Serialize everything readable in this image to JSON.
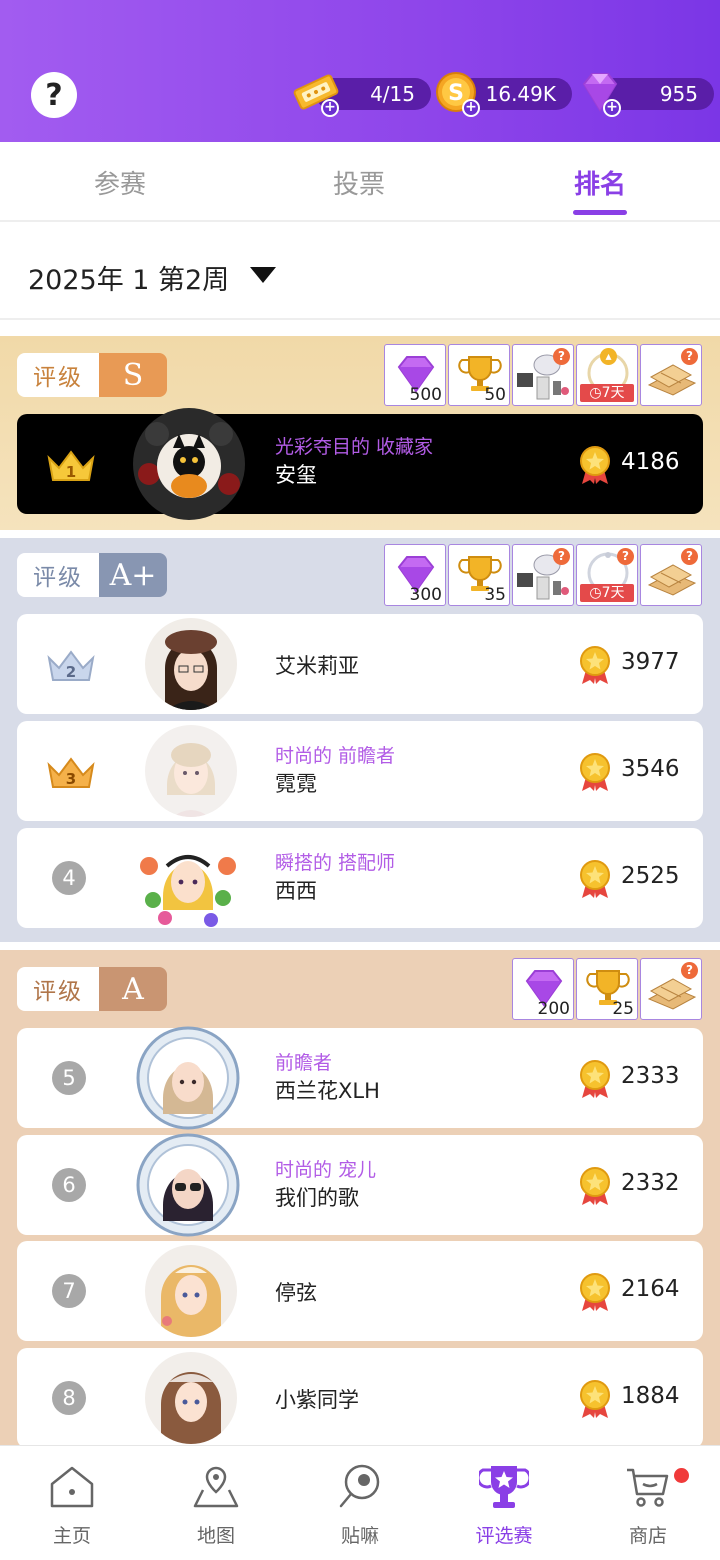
{
  "header": {
    "help_label": "?",
    "tickets": "4/15",
    "coins": "16.49K",
    "diamonds": "955",
    "accent_color": "#8e45ea"
  },
  "tabs": [
    {
      "label": "参赛",
      "active": false
    },
    {
      "label": "投票",
      "active": false
    },
    {
      "label": "排名",
      "active": true
    }
  ],
  "period": {
    "label": "2025年 1 第2周"
  },
  "tiers": {
    "s": {
      "label": "评级",
      "grade": "S",
      "rewards": [
        {
          "icon": "diamond-icon",
          "qty": "500"
        },
        {
          "icon": "trophy-icon",
          "qty": "50"
        },
        {
          "icon": "outfit-icon",
          "qty": ""
        },
        {
          "icon": "frame-icon",
          "qty": "",
          "timer": "7天"
        },
        {
          "icon": "chest-icon",
          "qty": ""
        }
      ]
    },
    "ap": {
      "label": "评级",
      "grade": "A+",
      "rewards": [
        {
          "icon": "diamond-icon",
          "qty": "300"
        },
        {
          "icon": "trophy-icon",
          "qty": "35"
        },
        {
          "icon": "outfit-icon",
          "qty": ""
        },
        {
          "icon": "frame-icon",
          "qty": "",
          "timer": "7天"
        },
        {
          "icon": "chest-icon",
          "qty": ""
        }
      ]
    },
    "a": {
      "label": "评级",
      "grade": "A",
      "rewards": [
        {
          "icon": "diamond-icon",
          "qty": "200"
        },
        {
          "icon": "trophy-icon",
          "qty": "25"
        },
        {
          "icon": "chest-icon",
          "qty": ""
        }
      ]
    }
  },
  "ranking": [
    {
      "rank": "1",
      "title": "光彩夺目的 收藏家",
      "name": "安玺",
      "score": "4186"
    },
    {
      "rank": "2",
      "title": "",
      "name": "艾米莉亚",
      "score": "3977"
    },
    {
      "rank": "3",
      "title": "时尚的 前瞻者",
      "name": "霓霓",
      "score": "3546"
    },
    {
      "rank": "4",
      "title": "瞬搭的 搭配师",
      "name": "西西",
      "score": "2525"
    },
    {
      "rank": "5",
      "title": "前瞻者",
      "name": "西兰花XLH",
      "score": "2333"
    },
    {
      "rank": "6",
      "title": "时尚的 宠儿",
      "name": "我们的歌",
      "score": "2332"
    },
    {
      "rank": "7",
      "title": "",
      "name": "停弦",
      "score": "2164"
    },
    {
      "rank": "8",
      "title": "",
      "name": "小紫同学",
      "score": "1884"
    }
  ],
  "bottom_nav": [
    {
      "label": "主页",
      "icon": "home-icon"
    },
    {
      "label": "地图",
      "icon": "map-icon"
    },
    {
      "label": "贴嘛",
      "icon": "post-icon"
    },
    {
      "label": "评选赛",
      "icon": "trophy-icon",
      "active": true
    },
    {
      "label": "商店",
      "icon": "cart-icon",
      "badge": true
    }
  ]
}
